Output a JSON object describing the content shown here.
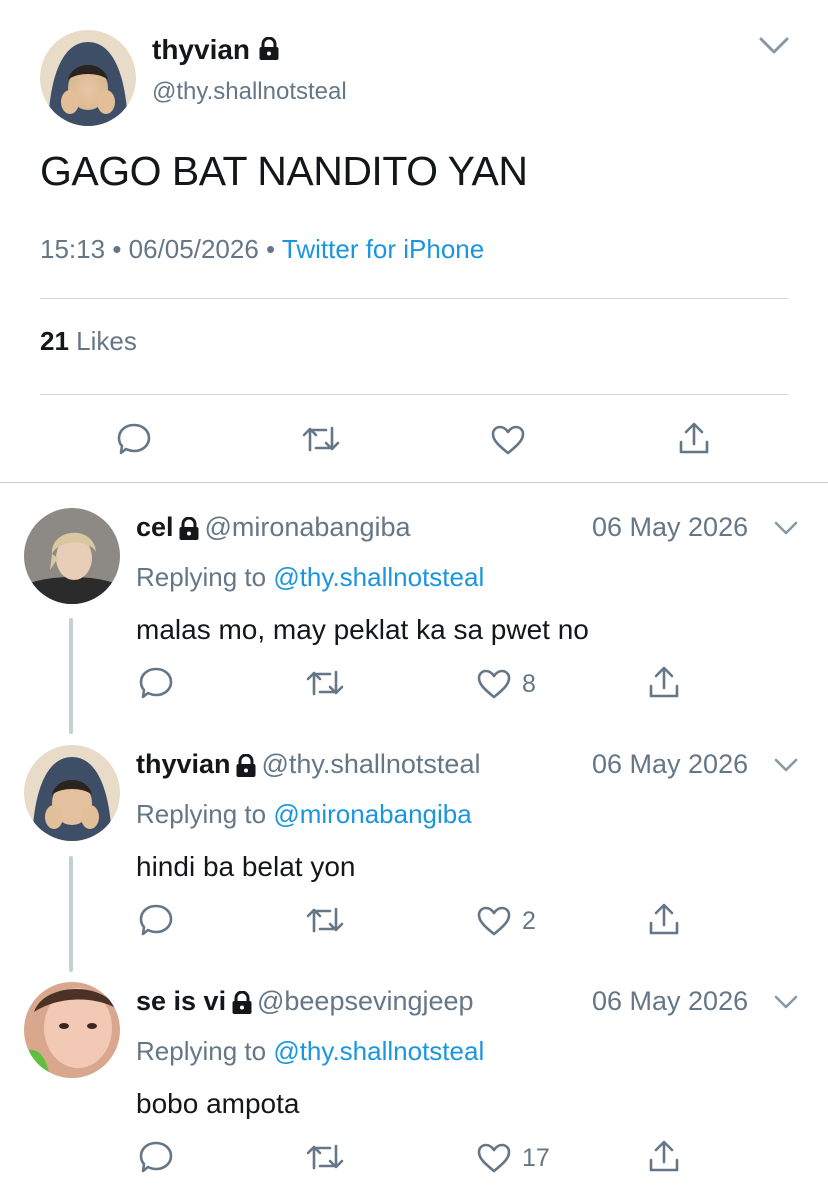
{
  "main_tweet": {
    "display_name": "thyvian",
    "handle": "@thy.shallnotsteal",
    "text": "GAGO BAT NANDITO YAN",
    "time": "15:13",
    "date": "06/05/2026",
    "source": "Twitter for iPhone",
    "likes_count": "21",
    "likes_label": "Likes",
    "separator": "•"
  },
  "replies": [
    {
      "display_name": "cel",
      "handle": "@mironabangiba",
      "date": "06 May 2026",
      "replying_prefix": "Replying to",
      "replying_to": "@thy.shallnotsteal",
      "text": "malas mo, may peklat ka sa pwet no",
      "like_count": "8"
    },
    {
      "display_name": "thyvian",
      "handle": "@thy.shallnotsteal",
      "date": "06 May 2026",
      "replying_prefix": "Replying to",
      "replying_to": "@mironabangiba",
      "text": "hindi ba belat yon",
      "like_count": "2"
    },
    {
      "display_name": "se is vi",
      "handle": "@beepsevingjeep",
      "date": "06 May 2026",
      "replying_prefix": "Replying to",
      "replying_to": "@thy.shallnotsteal",
      "text": "bobo ampota",
      "like_count": "17"
    }
  ],
  "colors": {
    "link": "#1b95e0",
    "secondary": "#657786",
    "primary": "#14171a",
    "divider": "#d4d8dc"
  },
  "icons": [
    "lock-icon",
    "chevron-down-icon",
    "reply-icon",
    "retweet-icon",
    "like-icon",
    "share-icon"
  ]
}
